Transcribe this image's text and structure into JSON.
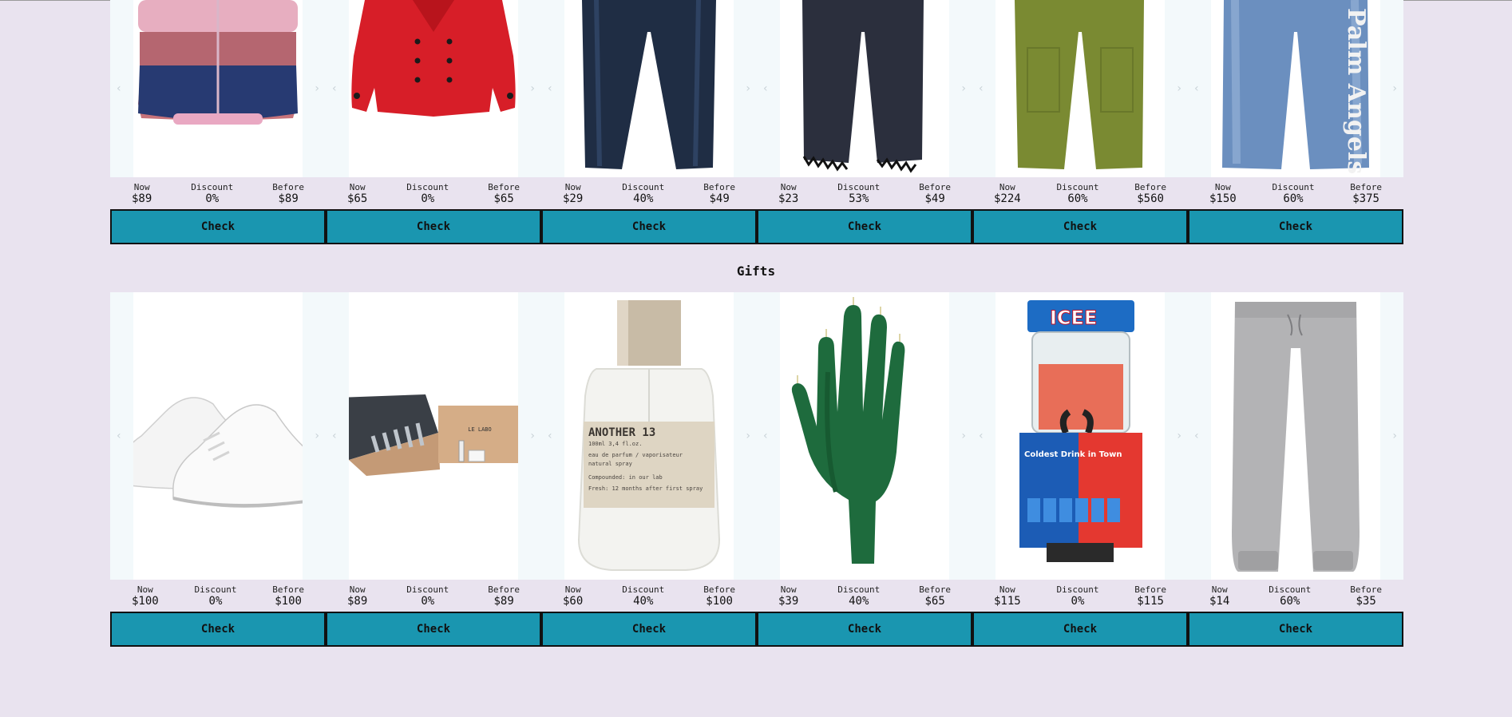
{
  "sections": [
    {
      "title": "",
      "products": [
        {
          "icon": "kids-puffer-jacket",
          "now": "$89",
          "discount": "0%",
          "before": "$89"
        },
        {
          "icon": "red-peacoat",
          "now": "$65",
          "discount": "0%",
          "before": "$65"
        },
        {
          "icon": "dark-jeans",
          "now": "$29",
          "discount": "40%",
          "before": "$49"
        },
        {
          "icon": "frayed-black-jeans",
          "now": "$23",
          "discount": "53%",
          "before": "$49"
        },
        {
          "icon": "olive-pants",
          "now": "$224",
          "discount": "60%",
          "before": "$560"
        },
        {
          "icon": "logo-jeans",
          "now": "$150",
          "discount": "60%",
          "before": "$375",
          "logo_text": "Palm Angels"
        }
      ]
    },
    {
      "title": "Gifts",
      "products": [
        {
          "icon": "white-sneakers",
          "now": "$100",
          "discount": "0%",
          "before": "$100"
        },
        {
          "icon": "perfume-kit",
          "now": "$89",
          "discount": "0%",
          "before": "$89",
          "box_text": "LE LABO"
        },
        {
          "icon": "perfume-bottle",
          "now": "$60",
          "discount": "40%",
          "before": "$100",
          "label_title": "ANOTHER 13",
          "label_sub": "100ml 3,4 fl.oz.",
          "label_line1": "eau de parfum / vaporisateur",
          "label_line2": "natural spray",
          "label_line3": "Compounded: in our lab",
          "label_line4": "Fresh:     12 months after first spray"
        },
        {
          "icon": "hand-candle",
          "now": "$39",
          "discount": "40%",
          "before": "$65"
        },
        {
          "icon": "icee-machine",
          "now": "$115",
          "discount": "0%",
          "before": "$115",
          "brand_text": "ICEE",
          "tag_text": "Coldest Drink in Town"
        },
        {
          "icon": "grey-joggers",
          "now": "$14",
          "discount": "60%",
          "before": "$35"
        }
      ]
    }
  ],
  "labels": {
    "now": "Now",
    "discount": "Discount",
    "before": "Before",
    "check": "Check",
    "prev": "‹",
    "next": "›"
  }
}
